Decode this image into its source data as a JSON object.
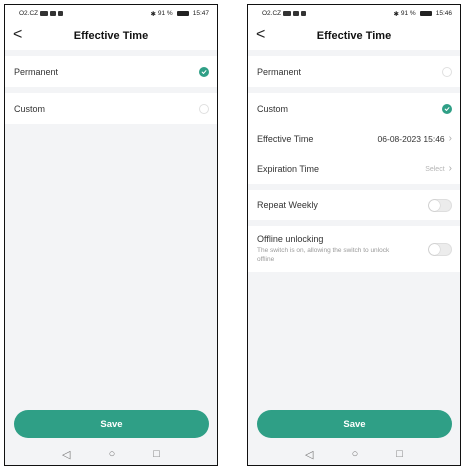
{
  "left": {
    "status": {
      "carrier": "O2.CZ",
      "battery": "91 %",
      "time": "15:47"
    },
    "header": {
      "back": "<",
      "title": "Effective Time"
    },
    "options": {
      "permanent": "Permanent",
      "custom": "Custom"
    },
    "save": "Save"
  },
  "right": {
    "status": {
      "carrier": "O2.CZ",
      "battery": "91 %",
      "time": "15:46"
    },
    "header": {
      "back": "<",
      "title": "Effective Time"
    },
    "options": {
      "permanent": "Permanent",
      "custom": "Custom"
    },
    "effective": {
      "label": "Effective Time",
      "value": "06-08-2023 15:46"
    },
    "expiration": {
      "label": "Expiration Time",
      "placeholder": "Select"
    },
    "repeat": {
      "label": "Repeat Weekly"
    },
    "offline": {
      "label": "Offline unlocking",
      "desc": "The switch is on, allowing the switch to unlock offline"
    },
    "save": "Save"
  },
  "nav": {
    "back": "◁",
    "home": "○",
    "recent": "□"
  },
  "icons": {
    "check": "check-icon",
    "chevron": "chevron-right-icon",
    "back": "back-arrow-icon"
  },
  "colors": {
    "accent": "#2f9f86"
  }
}
